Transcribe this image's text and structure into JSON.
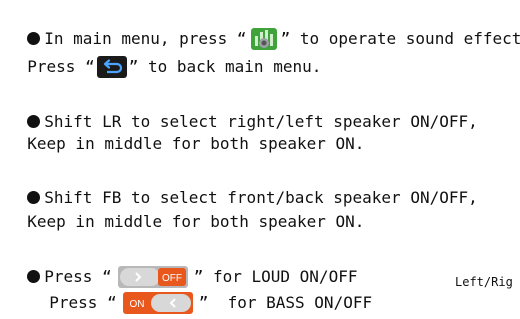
{
  "instructions": {
    "sound": {
      "pre": "In main menu, press “",
      "icon": "sound-effect-icon",
      "post": "” to operate sound effect"
    },
    "back": {
      "pre": "Press “",
      "icon": "back-arrow-icon",
      "post": "” to back main menu."
    },
    "lr": {
      "line1": "Shift LR to select right/left speaker ON/OFF,",
      "line2": "Keep in middle for both speaker ON."
    },
    "fb": {
      "line1": "Shift FB to select front/back speaker ON/OFF,",
      "line2": "Keep in middle for both speaker ON."
    },
    "loud": {
      "pre": "Press “",
      "toggle_state": "OFF",
      "post": "” for LOUD ON/OFF"
    },
    "bass": {
      "pre": "Press “",
      "toggle_state": "ON",
      "post": "”  for BASS ON/OFF"
    },
    "cutoff_text": "Left/Rig"
  },
  "colors": {
    "sound_icon_bg": "#3fa23a",
    "back_icon_bg": "#1a1a1a",
    "toggle_off_knob": "#d8d8d8",
    "toggle_active": "#e8581c"
  }
}
